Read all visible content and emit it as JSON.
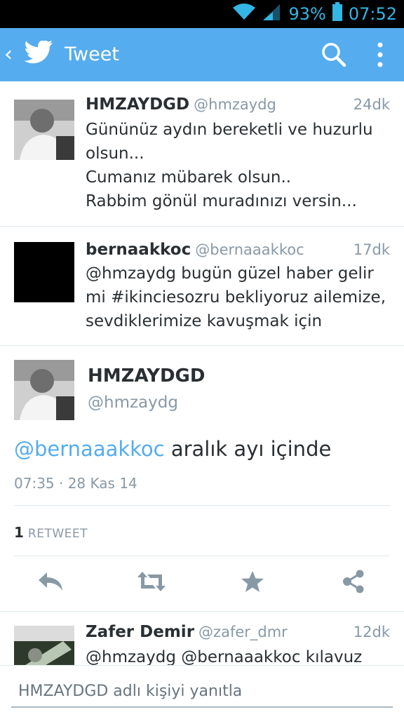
{
  "status_bar": {
    "battery_percent": "93%",
    "time": "07:52"
  },
  "app_bar": {
    "back_glyph": "‹",
    "title": "Tweet",
    "icons": [
      "twitter-bird-icon",
      "search-icon",
      "more-vert-icon"
    ]
  },
  "colors": {
    "brand": "#55acee",
    "status_icons": "#33b5e5",
    "secondary_text": "#8899a6",
    "mention": "#55acee"
  },
  "tweets": [
    {
      "name": "HMZAYDGD",
      "handle": "@hmzaydg",
      "time": "24dk",
      "text": "Gününüz aydın bereketli ve huzurlu olsun...\nCumanız mübarek olsun..\nRabbim gönül muradınızı versin..."
    },
    {
      "name": "bernaakkoc",
      "handle": "@bernaaakkoc",
      "time": "17dk",
      "text": "@hmzaydg bugün güzel haber gelir mi #ikinciesozru bekliyoruz ailemize, sevdiklerimize kavuşmak için"
    }
  ],
  "detail": {
    "name": "HMZAYDGD",
    "handle": "@hmzaydg",
    "mention": "@bernaaakkoc",
    "text": " aralık ayı içinde",
    "meta": "07:35 · 28 Kas 14",
    "retweet_count": "1",
    "retweet_label": "RETWEET",
    "actions": [
      "reply-icon",
      "retweet-icon",
      "favorite-icon",
      "share-icon"
    ]
  },
  "replies": [
    {
      "name": "Zafer Demir",
      "handle": "@zafer_dmr",
      "time": "12dk",
      "text": "@hmzaydg @bernaaakkoc kılavuz mu"
    }
  ],
  "reply_box": {
    "placeholder": "HMZAYDGD adlı kişiyi yanıtla"
  }
}
